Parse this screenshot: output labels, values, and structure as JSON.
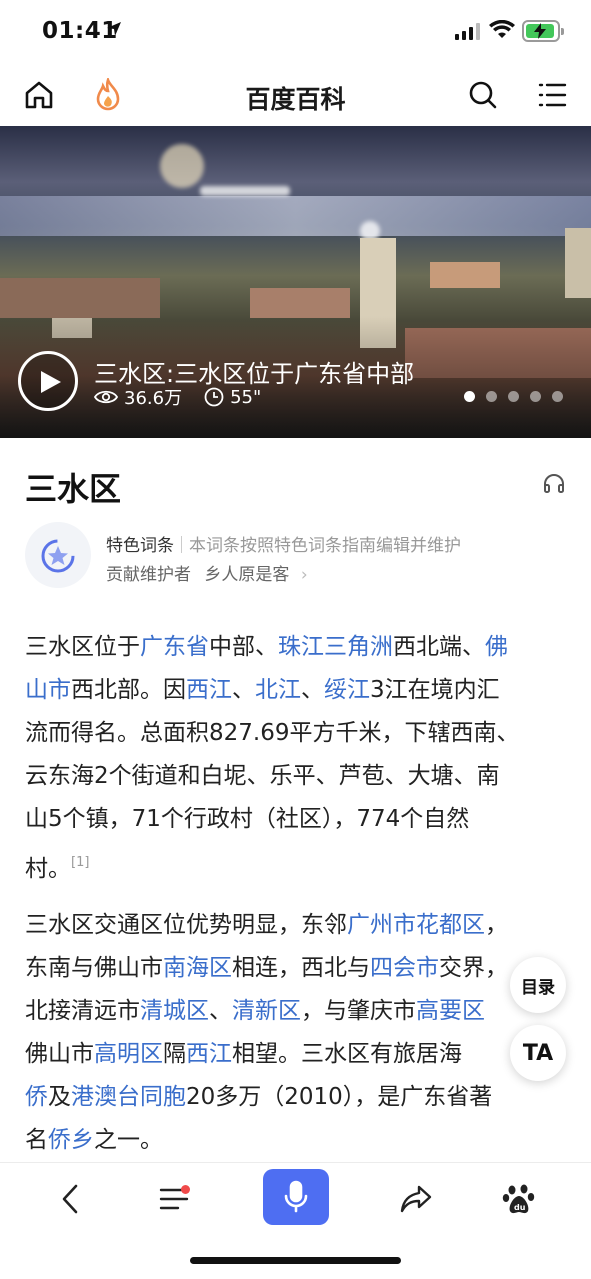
{
  "status_bar": {
    "time": "01:41"
  },
  "header": {
    "title": "百度百科",
    "icons": [
      "home-icon",
      "flame-icon",
      "search-icon",
      "menu-icon"
    ]
  },
  "hero": {
    "caption": "三水区:三水区位于广东省中部",
    "views": "36.6万",
    "duration": "55\"",
    "slide_count": 5,
    "active_slide": 1
  },
  "entry": {
    "title": "三水区"
  },
  "feature": {
    "label": "特色词条",
    "description": "本词条按照特色词条指南编辑并维护",
    "contributor_label": "贡献维护者",
    "contributor_name": "乡人原是客"
  },
  "paragraph1": {
    "l1a": "三水区位于",
    "l1b": "广东省",
    "l1c": "中部、",
    "l1d": "珠江三角洲",
    "l1e": "西北端、",
    "l1f": "佛",
    "l2a": "山市",
    "l2b": "西北部。因",
    "l2c": "西江",
    "l2d": "、",
    "l2e": "北江",
    "l2f": "、",
    "l2g": "绥江",
    "l2h": "3江在境内汇",
    "l3": "流而得名。总面积827.69平方千米，下辖西南、",
    "l4": "云东海2个街道和白坭、乐平、芦苞、大塘、南",
    "l5": "山5个镇，71个行政村（社区），774个自然",
    "l6": "村。",
    "ref": "[1]"
  },
  "paragraph2": {
    "l1a": "三水区交通区位优势明显，东邻",
    "l1b": "广州市花都区",
    "l1c": "，",
    "l2a": "东南与佛山市",
    "l2b": "南海区",
    "l2c": "相连，西北与",
    "l2d": "四会市",
    "l2e": "交界，",
    "l3a": "北接清远市",
    "l3b": "清城区",
    "l3c": "、",
    "l3d": "清新区",
    "l3e": "，与肇庆市",
    "l3f": "高要区",
    "l4a": "佛山市",
    "l4b": "高明区",
    "l4c": "隔",
    "l4d": "西江",
    "l4e": "相望。三水区有旅居海",
    "l5a": "侨",
    "l5b": "及",
    "l5c": "港澳台同胞",
    "l5d": "20多万（2010），是广东省著",
    "l6a": "名",
    "l6b": "侨乡",
    "l6c": "之一。"
  },
  "floating": {
    "toc": "目录",
    "font": "TA"
  },
  "bottom_bar": {
    "icons": [
      "back-icon",
      "list-icon",
      "microphone-icon",
      "share-icon",
      "baidu-paw-icon"
    ],
    "notification_dot": true
  },
  "colors": {
    "link": "#3a6ecb",
    "voice_button": "#4e6ef2",
    "battery": "#43c75a",
    "dot": "#f04a4a"
  }
}
